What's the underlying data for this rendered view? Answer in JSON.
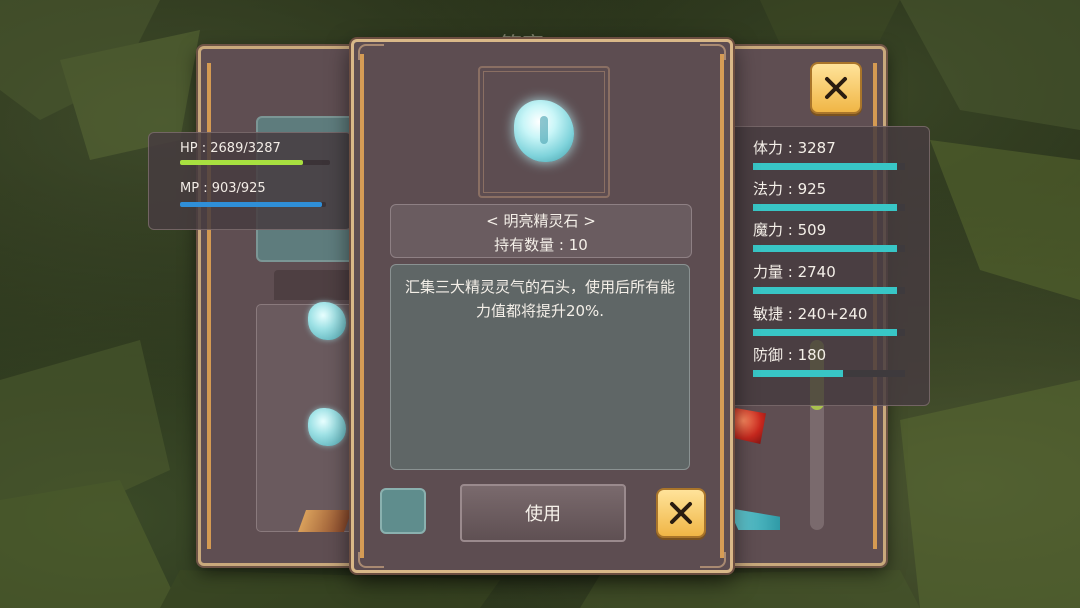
{
  "background_title": "策室",
  "hp_mp": {
    "hp": {
      "label": "HP : 2689/3287",
      "fill_fraction": 0.818,
      "color": "#a8e040"
    },
    "mp": {
      "label": "MP : 903/925",
      "fill_fraction": 0.976,
      "color": "#2f8fd8"
    }
  },
  "stats": [
    {
      "label": "体力 : 3287",
      "fill_fraction": 0.95
    },
    {
      "label": "法力 : 925",
      "fill_fraction": 0.95
    },
    {
      "label": "魔力 : 509",
      "fill_fraction": 0.95
    },
    {
      "label": "力量 : 2740",
      "fill_fraction": 0.95
    },
    {
      "label": "敏捷 : 240+240",
      "fill_fraction": 0.95
    },
    {
      "label": "防御 : 180",
      "fill_fraction": 0.59
    }
  ],
  "stat_bar_color": "#38c6c6",
  "dialog": {
    "item_name": "< 明亮精灵石 >",
    "quantity": "持有数量 : 10",
    "description": "汇集三大精灵灵气的石头，使用后所有能力值都将提升20%.",
    "use_label": "使用",
    "item_icon": "crystal-icon",
    "close_icon": "close-icon"
  }
}
